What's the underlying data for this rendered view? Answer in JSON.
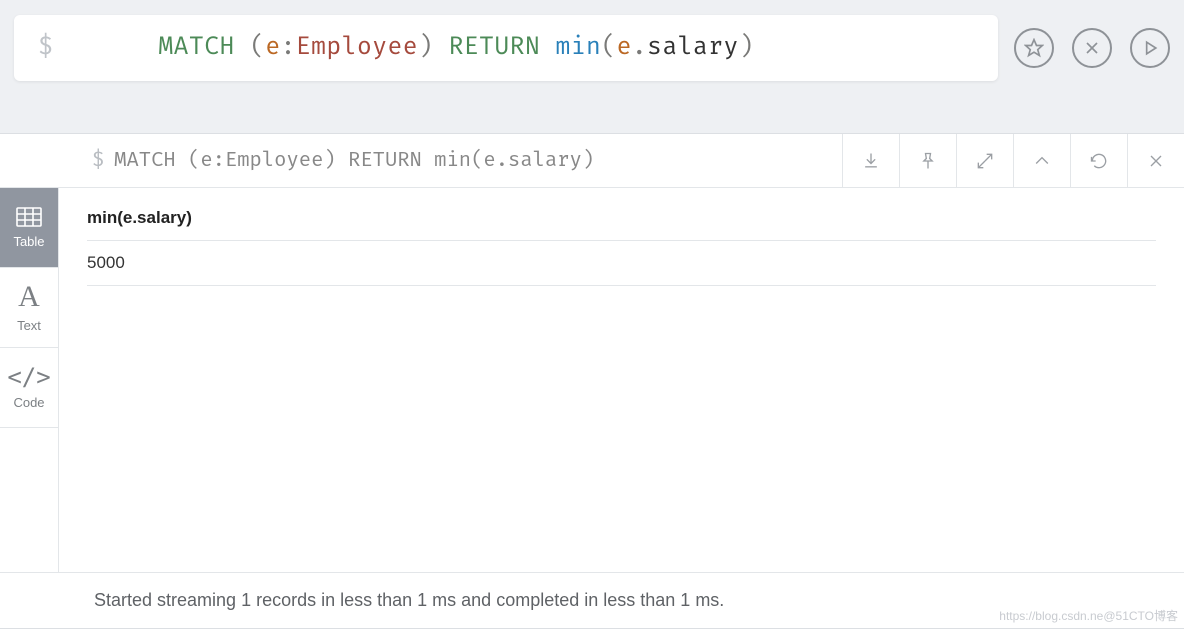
{
  "editor": {
    "prompt": "$",
    "tokens": {
      "match": "MATCH",
      "lp1": "(",
      "var1": "e",
      "colon": ":",
      "label": "Employee",
      "rp1": ")",
      "return": "RETURN",
      "fn": "min",
      "lp2": "(",
      "var2": "e",
      "dot": ".",
      "prop": "salary",
      "rp2": ")"
    }
  },
  "top_actions": {
    "favorite": "favorite",
    "clear": "clear",
    "run": "run"
  },
  "result": {
    "prompt": "$",
    "query_plain": "MATCH (e:Employee) RETURN min(e.salary)",
    "toolbar": {
      "download": "download",
      "pin": "pin",
      "expand": "expand",
      "collapse": "collapse",
      "rerun": "rerun",
      "close": "close"
    },
    "tabs": {
      "table": "Table",
      "text": "Text",
      "code": "Code"
    },
    "table": {
      "header": "min(e.salary)",
      "rows": [
        "5000"
      ]
    },
    "footer": "Started streaming 1 records in less than 1 ms and completed in less than 1 ms.",
    "watermark": "https://blog.csdn.ne@51CTO博客"
  }
}
